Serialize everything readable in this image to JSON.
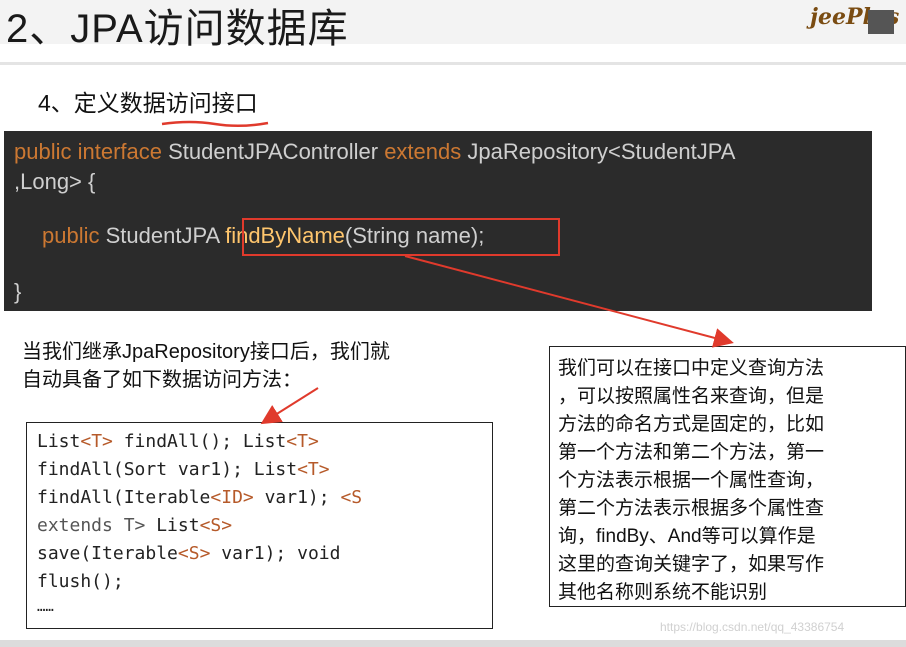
{
  "header": {
    "title": "2、JPA访问数据库",
    "brand": "jeePlus"
  },
  "section": {
    "heading": "4、定义数据访问接口"
  },
  "code": {
    "line1_kw1": "public",
    "line1_kw2": "interface",
    "line1_name": "StudentJPAController",
    "line1_kw3": "extends",
    "line1_rest": "JpaRepository<StudentJPA",
    "line2": ",Long> {",
    "line3_kw": "public",
    "line3_type": "StudentJPA",
    "line3_method": "findByName",
    "line3_params": "(String name);",
    "line4": "}"
  },
  "caption": {
    "line1": "当我们继承JpaRepository接口后，我们就",
    "line2": "自动具备了如下数据访问方法："
  },
  "methods": {
    "l1a": "List",
    "l1g1": "<T>",
    "l1b": " findAll(); List",
    "l1g2": "<T>",
    "l2a": "findAll(Sort var1); List",
    "l2g1": "<T>",
    "l3a": "findAll(Iterable",
    "l3g1": "<ID>",
    "l3b": " var1); ",
    "l3g2": "<S",
    "l4g1": "extends T>",
    "l4b": " List",
    "l4g2": "<S>",
    "l5a": "save(Iterable",
    "l5g1": "<S>",
    "l5b": " var1); void",
    "l6": "flush();",
    "l7": "……"
  },
  "note": {
    "lines": [
      "我们可以在接口中定义查询方法",
      "，可以按照属性名来查询，但是",
      "方法的命名方式是固定的，比如",
      "第一个方法和第二个方法，第一",
      "个方法表示根据一个属性查询，",
      "第二个方法表示根据多个属性查",
      "询，findBy、And等可以算作是",
      "这里的查询关键字了，如果写作",
      "其他名称则系统不能识别"
    ]
  },
  "watermark": "https://blog.csdn.net/qq_43386754",
  "colors": {
    "code_bg": "#2b2b2b",
    "keyword": "#cc7832",
    "method": "#ffc66d",
    "highlight": "#e03a2c"
  }
}
